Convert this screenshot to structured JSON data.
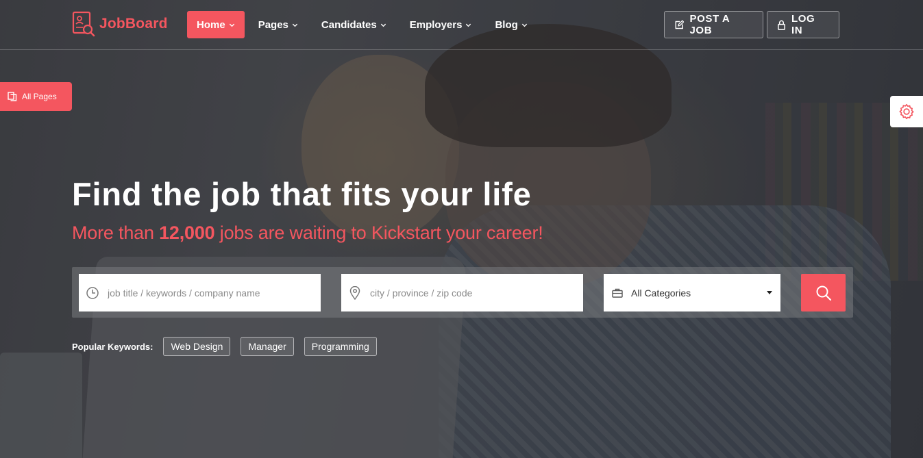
{
  "brand": {
    "name": "JobBoard",
    "accent_color": "#f4565f",
    "logo_icon": "document-search-icon"
  },
  "nav": {
    "items": [
      {
        "label": "Home",
        "active": true,
        "icon": "chevron-down-icon"
      },
      {
        "label": "Pages",
        "active": false,
        "icon": "chevron-down-icon"
      },
      {
        "label": "Candidates",
        "active": false,
        "icon": "chevron-down-icon"
      },
      {
        "label": "Employers",
        "active": false,
        "icon": "chevron-down-icon"
      },
      {
        "label": "Blog",
        "active": false,
        "icon": "chevron-down-icon"
      }
    ]
  },
  "header_actions": {
    "post_job": {
      "label": "POST A JOB",
      "icon": "edit-icon"
    },
    "login": {
      "label": "LOG IN",
      "icon": "lock-icon"
    }
  },
  "side": {
    "all_pages": {
      "label": "All Pages",
      "icon": "copy-icon"
    },
    "settings_icon": "gear-icon"
  },
  "hero": {
    "title": "Find the job that fits your life",
    "subtitle_prefix": "More than ",
    "subtitle_count": "12,000",
    "subtitle_suffix": " jobs are waiting to Kickstart your career!"
  },
  "search": {
    "keyword_placeholder": "job title / keywords / company name",
    "keyword_icon": "clock-icon",
    "location_placeholder": "city / province / zip code",
    "location_icon": "map-pin-icon",
    "category_selected": "All Categories",
    "category_icon": "briefcase-icon",
    "submit_icon": "search-icon"
  },
  "popular": {
    "label": "Popular Keywords:",
    "tags": [
      "Web Design",
      "Manager",
      "Programming"
    ]
  }
}
